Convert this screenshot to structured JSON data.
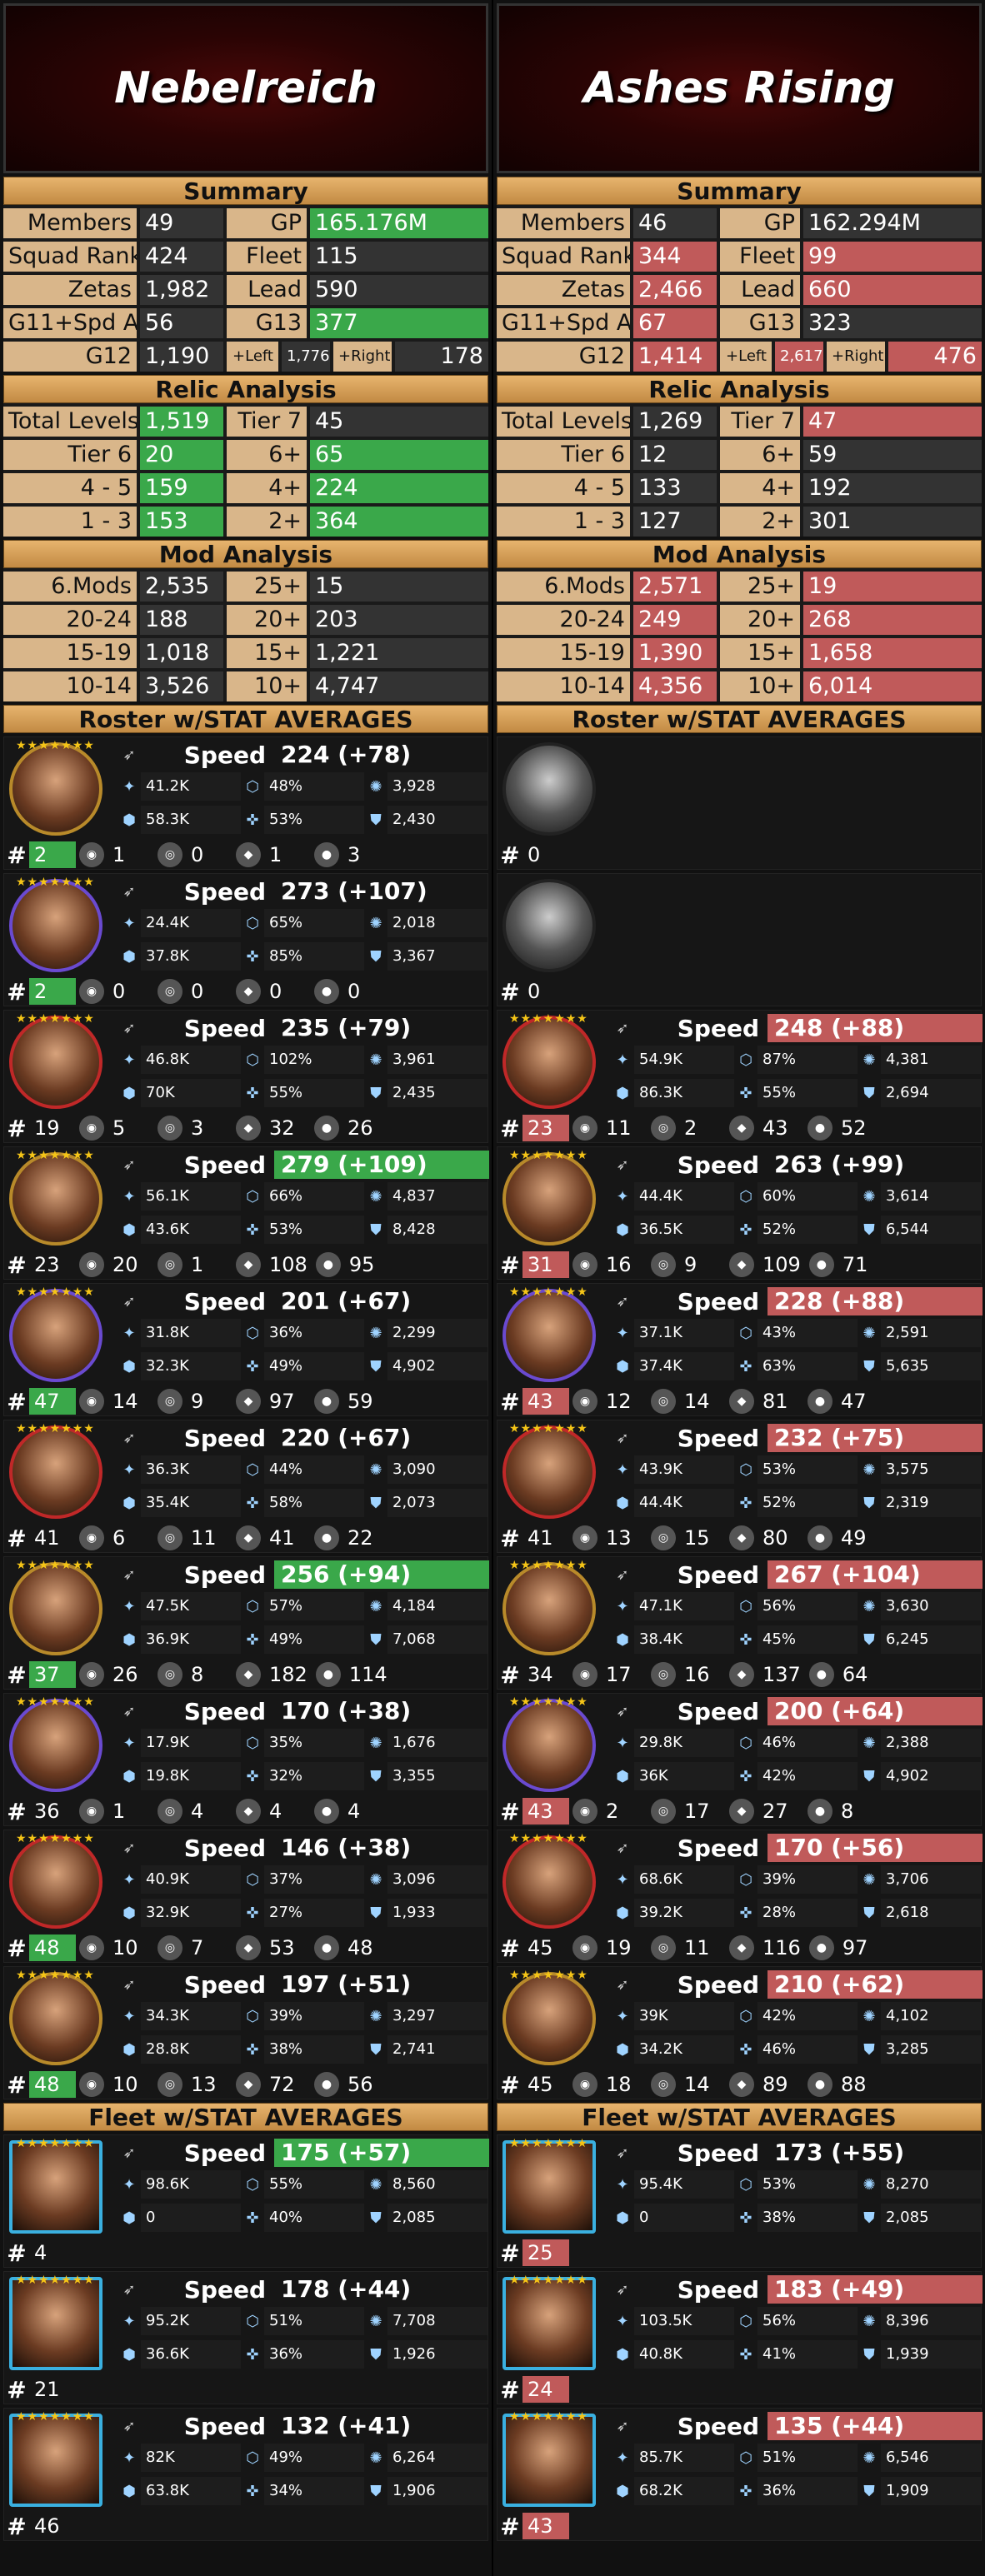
{
  "left": {
    "guild_name": "Nebelreich",
    "summary_title": "Summary",
    "summary": [
      [
        "Members",
        "49",
        "GP",
        "165.176M"
      ],
      [
        "Squad Rank",
        "424",
        "Fleet",
        "115"
      ],
      [
        "Zetas",
        "1,982",
        "Lead",
        "590"
      ],
      [
        "G11+Spd Avg",
        "56",
        "G13",
        "377"
      ]
    ],
    "g12": {
      "label": "G12",
      "value": "1,190",
      "left_label": "+Left",
      "left_value": "1,776",
      "right_label": "+Right",
      "right_value": "178"
    },
    "relic_title": "Relic Analysis",
    "relic": [
      [
        "Total Levels",
        "1,519",
        "Tier 7",
        "45"
      ],
      [
        "Tier 6",
        "20",
        "6+",
        "65"
      ],
      [
        "4 - 5",
        "159",
        "4+",
        "224"
      ],
      [
        "1 - 3",
        "153",
        "2+",
        "364"
      ]
    ],
    "mod_title": "Mod Analysis",
    "mods": [
      [
        "6.Mods",
        "2,535",
        "25+",
        "15"
      ],
      [
        "20-24",
        "188",
        "20+",
        "203"
      ],
      [
        "15-19",
        "1,018",
        "15+",
        "1,221"
      ],
      [
        "10-14",
        "3,526",
        "10+",
        "4,747"
      ]
    ],
    "roster_title": "Roster w/STAT AVERAGES",
    "fleet_title": "Fleet w/STAT AVERAGES"
  },
  "right": {
    "guild_name": "Ashes Rising",
    "summary_title": "Summary",
    "summary": [
      [
        "Members",
        "46",
        "GP",
        "162.294M"
      ],
      [
        "Squad Rank",
        "344",
        "Fleet",
        "99"
      ],
      [
        "Zetas",
        "2,466",
        "Lead",
        "660"
      ],
      [
        "G11+Spd Avg",
        "67",
        "G13",
        "323"
      ]
    ],
    "g12": {
      "label": "G12",
      "value": "1,414",
      "left_label": "+Left",
      "left_value": "2,617",
      "right_label": "+Right",
      "right_value": "476"
    },
    "relic_title": "Relic Analysis",
    "relic": [
      [
        "Total Levels",
        "1,269",
        "Tier 7",
        "47"
      ],
      [
        "Tier 6",
        "12",
        "6+",
        "59"
      ],
      [
        "4 - 5",
        "133",
        "4+",
        "192"
      ],
      [
        "1 - 3",
        "127",
        "2+",
        "301"
      ]
    ],
    "mod_title": "Mod Analysis",
    "mods": [
      [
        "6.Mods",
        "2,571",
        "25+",
        "19"
      ],
      [
        "20-24",
        "249",
        "20+",
        "268"
      ],
      [
        "15-19",
        "1,390",
        "15+",
        "1,658"
      ],
      [
        "10-14",
        "4,356",
        "10+",
        "6,014"
      ]
    ],
    "roster_title": "Roster w/STAT AVERAGES",
    "fleet_title": "Fleet w/STAT AVERAGES"
  },
  "speed_label": "Speed",
  "hash": "#",
  "colors": {
    "good": "#3aa84a",
    "bad": "#c05a5a",
    "label": "#d9b68a",
    "header": "#d9a15a"
  },
  "roster_left": [
    {
      "speed": "224 (+78)",
      "stats": [
        "41.2K",
        "48%",
        "3,928",
        "58.3K",
        "53%",
        "2,430"
      ],
      "count": "2",
      "b": [
        "1",
        "0",
        "1",
        "3"
      ]
    },
    {
      "speed": "273 (+107)",
      "stats": [
        "24.4K",
        "65%",
        "2,018",
        "37.8K",
        "85%",
        "3,367"
      ],
      "count": "2",
      "b": [
        "0",
        "0",
        "0",
        "0"
      ]
    },
    {
      "speed": "235 (+79)",
      "stats": [
        "46.8K",
        "102%",
        "3,961",
        "70K",
        "55%",
        "2,435"
      ],
      "count": "19",
      "b": [
        "5",
        "3",
        "32",
        "26"
      ]
    },
    {
      "speed": "279 (+109)",
      "stats": [
        "56.1K",
        "66%",
        "4,837",
        "43.6K",
        "53%",
        "8,428"
      ],
      "count": "23",
      "b": [
        "20",
        "1",
        "108",
        "95"
      ]
    },
    {
      "speed": "201 (+67)",
      "stats": [
        "31.8K",
        "36%",
        "2,299",
        "32.3K",
        "49%",
        "4,902"
      ],
      "count": "47",
      "b": [
        "14",
        "9",
        "97",
        "59"
      ]
    },
    {
      "speed": "220 (+67)",
      "stats": [
        "36.3K",
        "44%",
        "3,090",
        "35.4K",
        "58%",
        "2,073"
      ],
      "count": "41",
      "b": [
        "6",
        "11",
        "41",
        "22"
      ]
    },
    {
      "speed": "256 (+94)",
      "stats": [
        "47.5K",
        "57%",
        "4,184",
        "36.9K",
        "49%",
        "7,068"
      ],
      "count": "37",
      "b": [
        "26",
        "8",
        "182",
        "114"
      ]
    },
    {
      "speed": "170 (+38)",
      "stats": [
        "17.9K",
        "35%",
        "1,676",
        "19.8K",
        "32%",
        "3,355"
      ],
      "count": "36",
      "b": [
        "1",
        "4",
        "4",
        "4"
      ]
    },
    {
      "speed": "146 (+38)",
      "stats": [
        "40.9K",
        "37%",
        "3,096",
        "32.9K",
        "27%",
        "1,933"
      ],
      "count": "48",
      "b": [
        "10",
        "7",
        "53",
        "48"
      ]
    },
    {
      "speed": "197 (+51)",
      "stats": [
        "34.3K",
        "39%",
        "3,297",
        "28.8K",
        "38%",
        "2,741"
      ],
      "count": "48",
      "b": [
        "10",
        "13",
        "72",
        "56"
      ]
    }
  ],
  "roster_right": [
    {
      "speed": "",
      "stats": [],
      "count": "0",
      "b": []
    },
    {
      "speed": "",
      "stats": [],
      "count": "0",
      "b": []
    },
    {
      "speed": "248 (+88)",
      "stats": [
        "54.9K",
        "87%",
        "4,381",
        "86.3K",
        "55%",
        "2,694"
      ],
      "count": "23",
      "b": [
        "11",
        "2",
        "43",
        "52"
      ]
    },
    {
      "speed": "263 (+99)",
      "stats": [
        "44.4K",
        "60%",
        "3,614",
        "36.5K",
        "52%",
        "6,544"
      ],
      "count": "31",
      "b": [
        "16",
        "9",
        "109",
        "71"
      ]
    },
    {
      "speed": "228 (+88)",
      "stats": [
        "37.1K",
        "43%",
        "2,591",
        "37.4K",
        "63%",
        "5,635"
      ],
      "count": "43",
      "b": [
        "12",
        "14",
        "81",
        "47"
      ]
    },
    {
      "speed": "232 (+75)",
      "stats": [
        "43.9K",
        "53%",
        "3,575",
        "44.4K",
        "52%",
        "2,319"
      ],
      "count": "41",
      "b": [
        "13",
        "15",
        "80",
        "49"
      ]
    },
    {
      "speed": "267 (+104)",
      "stats": [
        "47.1K",
        "56%",
        "3,630",
        "38.4K",
        "45%",
        "6,245"
      ],
      "count": "34",
      "b": [
        "17",
        "16",
        "137",
        "64"
      ]
    },
    {
      "speed": "200 (+64)",
      "stats": [
        "29.8K",
        "46%",
        "2,388",
        "36K",
        "42%",
        "4,902"
      ],
      "count": "43",
      "b": [
        "2",
        "17",
        "27",
        "8"
      ]
    },
    {
      "speed": "170 (+56)",
      "stats": [
        "68.6K",
        "39%",
        "3,706",
        "39.2K",
        "28%",
        "2,618"
      ],
      "count": "45",
      "b": [
        "19",
        "11",
        "116",
        "97"
      ]
    },
    {
      "speed": "210 (+62)",
      "stats": [
        "39K",
        "42%",
        "4,102",
        "34.2K",
        "46%",
        "3,285"
      ],
      "count": "45",
      "b": [
        "18",
        "14",
        "89",
        "88"
      ]
    }
  ],
  "fleet_left": [
    {
      "speed": "175 (+57)",
      "stats": [
        "98.6K",
        "55%",
        "8,560",
        "0",
        "40%",
        "2,085"
      ],
      "count": "4"
    },
    {
      "speed": "178 (+44)",
      "stats": [
        "95.2K",
        "51%",
        "7,708",
        "36.6K",
        "36%",
        "1,926"
      ],
      "count": "21"
    },
    {
      "speed": "132 (+41)",
      "stats": [
        "82K",
        "49%",
        "6,264",
        "63.8K",
        "34%",
        "1,906"
      ],
      "count": "46"
    }
  ],
  "fleet_right": [
    {
      "speed": "173 (+55)",
      "stats": [
        "95.4K",
        "53%",
        "8,270",
        "0",
        "38%",
        "2,085"
      ],
      "count": "25"
    },
    {
      "speed": "183 (+49)",
      "stats": [
        "103.5K",
        "56%",
        "8,396",
        "40.8K",
        "41%",
        "1,939"
      ],
      "count": "24"
    },
    {
      "speed": "135 (+44)",
      "stats": [
        "85.7K",
        "51%",
        "6,546",
        "68.2K",
        "36%",
        "1,909"
      ],
      "count": "43"
    }
  ]
}
